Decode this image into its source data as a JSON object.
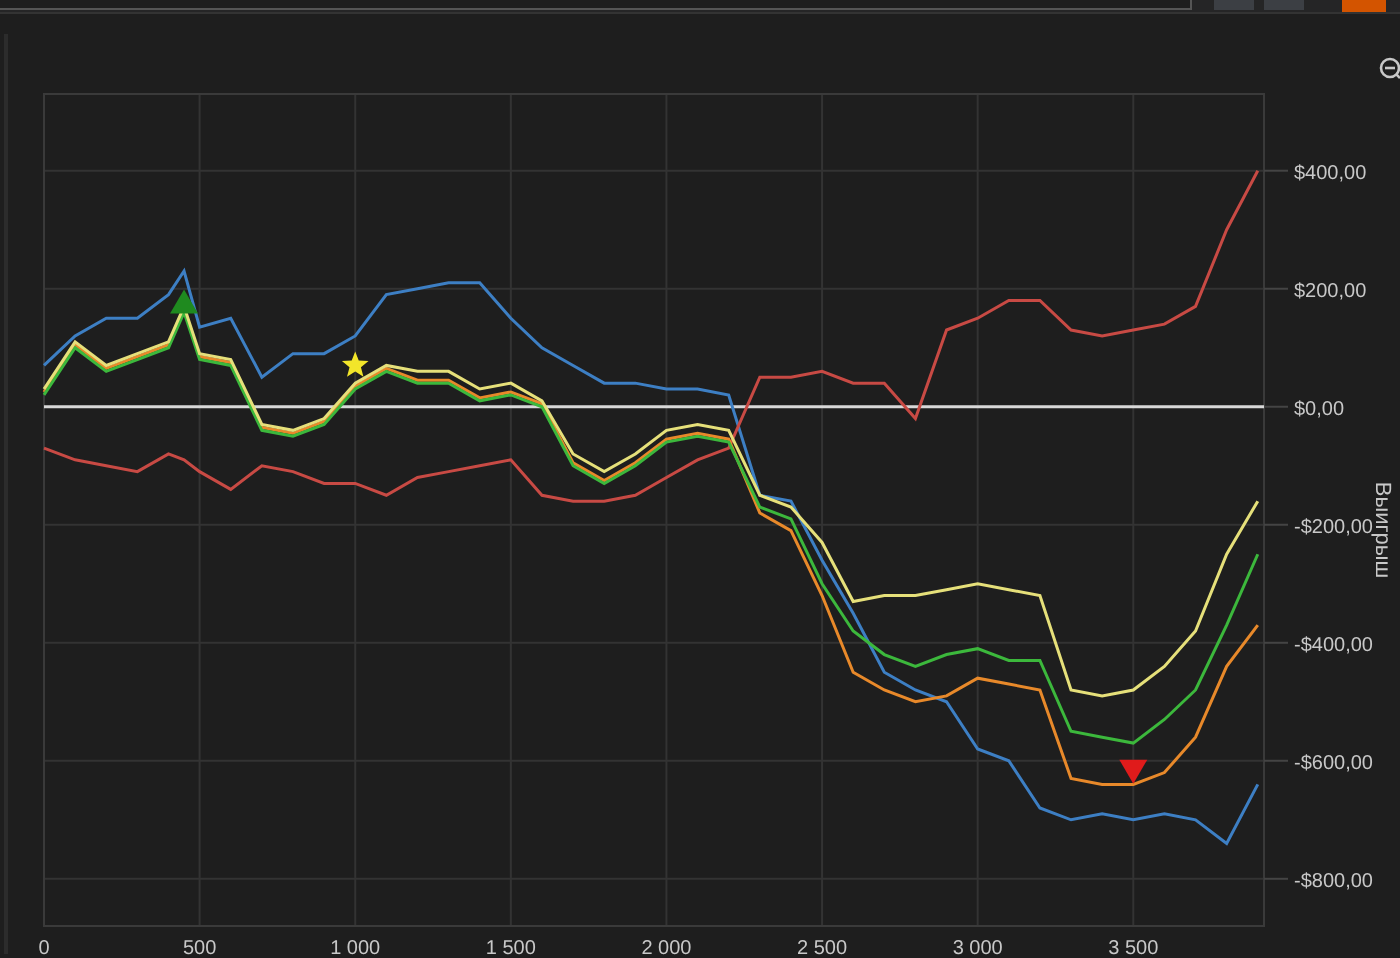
{
  "toolbar_buttons": [
    {
      "selected": false
    },
    {
      "selected": false
    },
    {
      "selected": true
    }
  ],
  "chart_data": {
    "type": "line",
    "ylabel": "Выигрыш",
    "x": [
      0,
      100,
      200,
      300,
      400,
      450,
      500,
      600,
      700,
      800,
      900,
      1000,
      1100,
      1200,
      1300,
      1400,
      1500,
      1600,
      1700,
      1800,
      1900,
      2000,
      2100,
      2200,
      2300,
      2400,
      2500,
      2600,
      2700,
      2800,
      2900,
      3000,
      3100,
      3200,
      3300,
      3400,
      3500,
      3600,
      3700,
      3800,
      3900
    ],
    "grid": true,
    "xlim": [
      0,
      3920
    ],
    "ylim": [
      -880,
      530
    ],
    "xticks": [
      {
        "value": 0,
        "label": "0"
      },
      {
        "value": 500,
        "label": "500"
      },
      {
        "value": 1000,
        "label": "1 000"
      },
      {
        "value": 1500,
        "label": "1 500"
      },
      {
        "value": 2000,
        "label": "2 000"
      },
      {
        "value": 2500,
        "label": "2 500"
      },
      {
        "value": 3000,
        "label": "3 000"
      },
      {
        "value": 3500,
        "label": "3 500"
      }
    ],
    "yticks": [
      {
        "value": 400,
        "label": "$400,00"
      },
      {
        "value": 200,
        "label": "$200,00"
      },
      {
        "value": 0,
        "label": "$0,00"
      },
      {
        "value": -200,
        "label": "-$200,00"
      },
      {
        "value": -400,
        "label": "-$400,00"
      },
      {
        "value": -600,
        "label": "-$600,00"
      },
      {
        "value": -800,
        "label": "-$800,00"
      }
    ],
    "series": [
      {
        "color": "#3d7fc4",
        "values": [
          70,
          120,
          150,
          150,
          190,
          230,
          135,
          150,
          50,
          90,
          90,
          120,
          190,
          200,
          210,
          210,
          150,
          100,
          70,
          40,
          40,
          30,
          30,
          20,
          -150,
          -160,
          -260,
          -350,
          -450,
          -480,
          -500,
          -580,
          -600,
          -680,
          -700,
          -690,
          -700,
          -690,
          -700,
          -740,
          -640
        ]
      },
      {
        "color": "#c84a44",
        "values": [
          -70,
          -90,
          -100,
          -110,
          -80,
          -90,
          -110,
          -140,
          -100,
          -110,
          -130,
          -130,
          -150,
          -120,
          -110,
          -100,
          -90,
          -150,
          -160,
          -160,
          -150,
          -120,
          -90,
          -70,
          50,
          50,
          60,
          40,
          40,
          -20,
          130,
          150,
          180,
          180,
          130,
          120,
          130,
          140,
          170,
          300,
          400
        ]
      },
      {
        "color": "#e8892a",
        "values": [
          25,
          105,
          65,
          85,
          105,
          165,
          85,
          75,
          -35,
          -45,
          -25,
          35,
          65,
          45,
          45,
          15,
          25,
          5,
          -95,
          -125,
          -95,
          -55,
          -45,
          -55,
          -180,
          -210,
          -320,
          -450,
          -480,
          -500,
          -490,
          -460,
          -470,
          -480,
          -630,
          -640,
          -640,
          -620,
          -560,
          -440,
          -370
        ]
      },
      {
        "color": "#3cb83c",
        "values": [
          20,
          100,
          60,
          80,
          100,
          160,
          80,
          70,
          -40,
          -50,
          -30,
          30,
          60,
          40,
          40,
          10,
          20,
          0,
          -100,
          -130,
          -100,
          -60,
          -50,
          -60,
          -170,
          -190,
          -300,
          -380,
          -420,
          -440,
          -420,
          -410,
          -430,
          -430,
          -550,
          -560,
          -570,
          -530,
          -480,
          -370,
          -250
        ]
      },
      {
        "color": "#e6e07a",
        "values": [
          30,
          110,
          70,
          90,
          110,
          170,
          90,
          80,
          -30,
          -40,
          -20,
          40,
          70,
          60,
          60,
          30,
          40,
          10,
          -80,
          -110,
          -80,
          -40,
          -30,
          -40,
          -150,
          -170,
          -230,
          -330,
          -320,
          -320,
          -310,
          -300,
          -310,
          -320,
          -480,
          -490,
          -480,
          -440,
          -380,
          -250,
          -160
        ]
      }
    ]
  },
  "markers": [
    {
      "kind": "up",
      "color": "#1f8a1f"
    },
    {
      "kind": "star",
      "color": "#f2e52a"
    },
    {
      "kind": "down",
      "color": "#e01b1b"
    }
  ]
}
